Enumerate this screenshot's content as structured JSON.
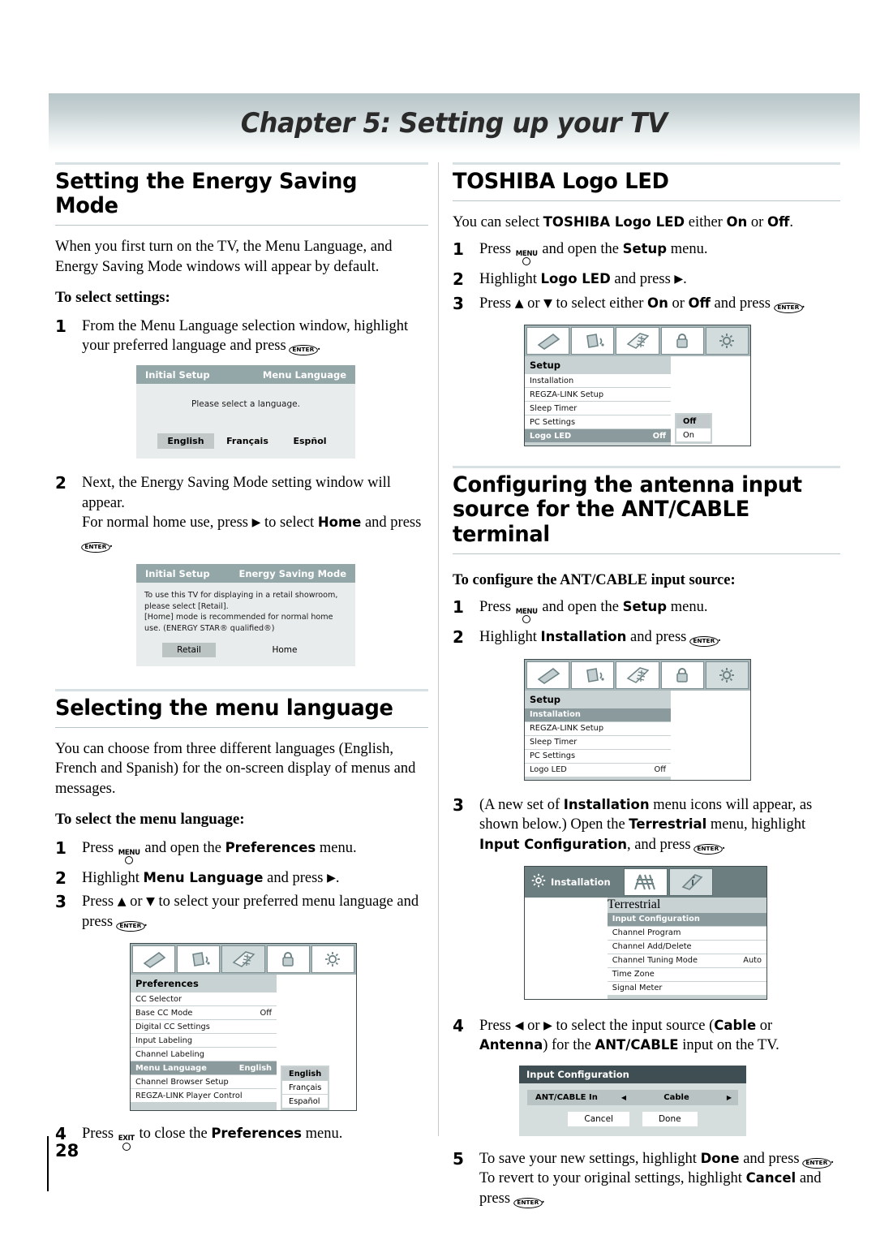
{
  "chapter": {
    "title": "Chapter 5: Setting up your TV"
  },
  "page_number": "28",
  "left": {
    "section1": {
      "heading": "Setting the Energy Saving Mode",
      "intro": "When you first turn on the TV, the Menu Language, and Energy Saving Mode windows will appear by default.",
      "subhead": "To select settings:",
      "steps": [
        {
          "num": "1",
          "text_a": "From the Menu Language selection window, highlight your preferred language and press ",
          "key": "ENTER",
          "text_b": "."
        },
        {
          "num": "2",
          "text_a": "Next, the Energy Saving Mode setting window will appear.",
          "text_b": "For normal home use, press ",
          "bold": "Home",
          "text_c": " to select ",
          "text_d": " and press ",
          "key": "ENTER",
          "text_e": "."
        }
      ],
      "osd_menu_language": {
        "title_left": "Initial Setup",
        "title_right": "Menu Language",
        "message": "Please select a language.",
        "options": [
          "English",
          "Français",
          "Espñol"
        ],
        "selected": "English"
      },
      "osd_energy_saving": {
        "title_left": "Initial Setup",
        "title_right": "Energy Saving Mode",
        "message_line1": "To use this TV for displaying in a retail showroom,",
        "message_line2": "please select [Retail].",
        "message_line3": "[Home] mode is recommended for normal home",
        "message_line4": "use. (ENERGY STAR® qualified®)",
        "options": [
          "Retail",
          "Home"
        ],
        "selected": "Retail"
      }
    },
    "section2": {
      "heading": "Selecting the menu language",
      "intro": "You can choose from three different languages (English, French and Spanish) for the on-screen display of menus and messages.",
      "subhead": "To select the menu language:",
      "steps": [
        {
          "num": "1",
          "a": "Press ",
          "key": "MENU",
          "b": " and open the ",
          "bold": "Preferences",
          "c": " menu."
        },
        {
          "num": "2",
          "a": "Highlight ",
          "bold": "Menu Language",
          "b": " and press ",
          "arrow": "▶",
          "c": "."
        },
        {
          "num": "3",
          "a": "Press ",
          "up": "▲",
          "b": " or ",
          "down": "▼",
          "c": " to select your preferred menu language and press ",
          "key": "ENTER",
          "d": "."
        },
        {
          "num": "4",
          "a": "Press ",
          "key": "EXIT",
          "b": " to close the ",
          "bold": "Preferences",
          "c": " menu."
        }
      ],
      "osd_preferences": {
        "icons": [
          "picture-icon",
          "audio-icon",
          "preferences-icon",
          "lock-icon",
          "setup-icon"
        ],
        "active_icon_index": 2,
        "menu_title": "Preferences",
        "rows": [
          {
            "label": "CC Selector",
            "value": ""
          },
          {
            "label": "Base CC Mode",
            "value": "Off"
          },
          {
            "label": "Digital CC Settings",
            "value": ""
          },
          {
            "label": "Input Labeling",
            "value": ""
          },
          {
            "label": "Channel Labeling",
            "value": ""
          },
          {
            "label": "Menu Language",
            "value": "English",
            "selected": true
          },
          {
            "label": "Channel Browser Setup",
            "value": ""
          },
          {
            "label": "REGZA-LINK Player Control",
            "value": ""
          }
        ],
        "submenu": [
          "English",
          "Français",
          "Español"
        ],
        "submenu_selected": "English"
      }
    }
  },
  "right": {
    "section1": {
      "heading": "TOSHIBA Logo LED",
      "intro_a": "You can select ",
      "intro_bold1": "TOSHIBA Logo LED",
      "intro_b": " either ",
      "intro_bold2": "On",
      "intro_c": " or ",
      "intro_bold3": "Off",
      "intro_d": ".",
      "steps": [
        {
          "num": "1",
          "a": "Press ",
          "key": "MENU",
          "b": " and open the ",
          "bold": "Setup",
          "c": " menu."
        },
        {
          "num": "2",
          "a": "Highlight ",
          "bold": "Logo LED",
          "b": " and press ",
          "arrow": "▶",
          "c": "."
        },
        {
          "num": "3",
          "a": "Press ",
          "up": "▲",
          "b": " or ",
          "down": "▼",
          "c": " to select either ",
          "bold1": "On",
          "d": " or ",
          "bold2": "Off",
          "e": " and press ",
          "key": "ENTER",
          "f": "."
        }
      ],
      "osd_setup": {
        "icons": [
          "picture-icon",
          "audio-icon",
          "preferences-icon",
          "lock-icon",
          "setup-icon"
        ],
        "active_icon_index": 4,
        "menu_title": "Setup",
        "rows": [
          {
            "label": "Installation",
            "value": ""
          },
          {
            "label": "REGZA-LINK Setup",
            "value": ""
          },
          {
            "label": "Sleep Timer",
            "value": ""
          },
          {
            "label": "PC Settings",
            "value": ""
          },
          {
            "label": "Logo LED",
            "value": "Off",
            "selected": true
          }
        ],
        "submenu": [
          "Off",
          "On"
        ],
        "submenu_selected": "Off"
      }
    },
    "section2": {
      "heading_line1": "Configuring the antenna input",
      "heading_line2": "source for the ANT/CABLE terminal",
      "subhead": "To configure the ANT/CABLE input source:",
      "steps": [
        {
          "num": "1",
          "a": "Press ",
          "key": "MENU",
          "b": " and open the ",
          "bold": "Setup",
          "c": " menu."
        },
        {
          "num": "2",
          "a": "Highlight ",
          "bold": "Installation",
          "b": " and press ",
          "key": "ENTER",
          "c": "."
        },
        {
          "num": "3",
          "a": "(A new set of ",
          "bold1": "Installation",
          "b": " menu icons will appear, as shown below.) Open the ",
          "bold2": "Terrestrial",
          "c": " menu, highlight ",
          "bold3": "Input Configuration",
          "d": ", and press ",
          "key": "ENTER",
          "e": "."
        },
        {
          "num": "4",
          "a": "Press ",
          "left": "◀",
          "b": " or ",
          "right": "▶",
          "c": " to select the input source (",
          "bold1": "Cable",
          "d": " or ",
          "bold2": "Antenna",
          "e": ") for the ",
          "bold3": "ANT/CABLE",
          "f": " input on the TV."
        },
        {
          "num": "5",
          "a": "To save your new settings, highlight ",
          "bold1": "Done",
          "b": " and press ",
          "key1": "ENTER",
          "c": ". To revert to your original settings, highlight ",
          "bold2": "Cancel",
          "d": " and press ",
          "key2": "ENTER",
          "e": "."
        }
      ],
      "osd_setup2": {
        "icons": [
          "picture-icon",
          "audio-icon",
          "preferences-icon",
          "lock-icon",
          "setup-icon"
        ],
        "active_icon_index": 4,
        "menu_title": "Setup",
        "rows": [
          {
            "label": "Installation",
            "value": "",
            "selected": true
          },
          {
            "label": "REGZA-LINK Setup",
            "value": ""
          },
          {
            "label": "Sleep Timer",
            "value": ""
          },
          {
            "label": "PC Settings",
            "value": ""
          },
          {
            "label": "Logo LED",
            "value": "Off"
          }
        ]
      },
      "osd_installation": {
        "header_label": "Installation",
        "header_icon": "setup-gear-icon",
        "icons": [
          "antenna-icon",
          "information-icon"
        ],
        "active_icon_index": 0,
        "menu_title": "Terrestrial",
        "rows": [
          {
            "label": "Input Configuration",
            "value": "",
            "selected": true
          },
          {
            "label": "Channel Program",
            "value": ""
          },
          {
            "label": "Channel Add/Delete",
            "value": ""
          },
          {
            "label": "Channel Tuning Mode",
            "value": "Auto"
          },
          {
            "label": "Time Zone",
            "value": ""
          },
          {
            "label": "Signal Meter",
            "value": ""
          }
        ]
      },
      "osd_input_config": {
        "title": "Input Configuration",
        "row_label": "ANT/CABLE In",
        "row_value": "Cable",
        "left_arrow": "◀",
        "right_arrow": "▶",
        "buttons": [
          "Cancel",
          "Done"
        ]
      }
    }
  },
  "colors": {
    "banner_top": "#b7c5c8",
    "osd_titlebar": "#93a6a8",
    "osd_dark_bar": "#3e4e52",
    "osd_panel": "#c9d2d3",
    "osd_selected": "#8b9b9d",
    "icon_teal": "#7f9093"
  }
}
